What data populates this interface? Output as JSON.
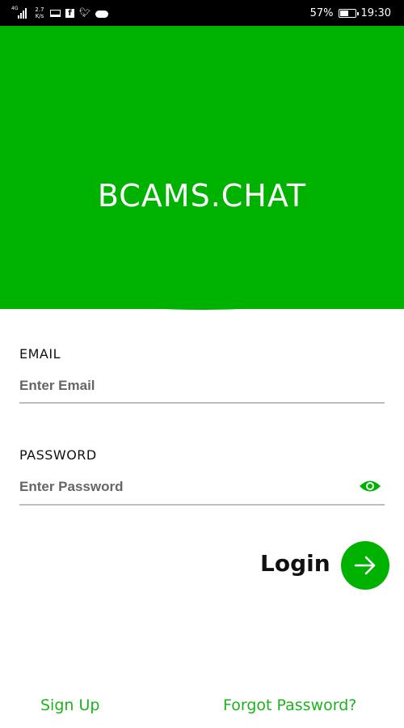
{
  "status_bar": {
    "network_label": "4G",
    "speed_value": "2.7",
    "speed_unit": "K/s",
    "battery": "57%",
    "battery_level": 0.57,
    "time": "19:30"
  },
  "header": {
    "title": "BCAMS.CHAT",
    "color": "#00b200"
  },
  "form": {
    "email_label": "EMAIL",
    "email_placeholder": "Enter Email",
    "email_value": "",
    "password_label": "PASSWORD",
    "password_placeholder": "Enter Password",
    "password_value": ""
  },
  "login": {
    "label": "Login"
  },
  "footer": {
    "sign_up": "Sign Up",
    "forgot_password": "Forgot Password?"
  },
  "icons": [
    "signal-icon",
    "laptop-icon",
    "facebook-icon",
    "twitter-icon",
    "cloud-icon",
    "battery-icon",
    "eye-icon",
    "arrow-right-icon"
  ]
}
